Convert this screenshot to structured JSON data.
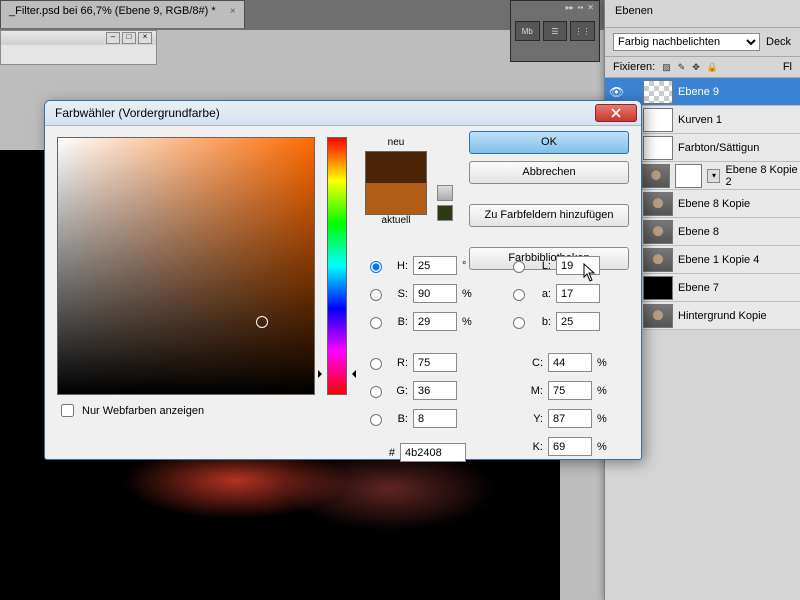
{
  "tab": {
    "title": "_Filter.psd bei 66,7% (Ebene 9, RGB/8#) *",
    "close": "×"
  },
  "panels": {
    "layers_tab": "Ebenen",
    "blend_mode": "Farbig nachbelichten",
    "deck": "Deck",
    "fix": "Fixieren:",
    "fl": "Fl",
    "mb": "Mb"
  },
  "layers": [
    {
      "name": "Ebene 9",
      "thumb": "chk",
      "selected": true
    },
    {
      "name": "Kurven 1",
      "thumb": "mask",
      "adj": true
    },
    {
      "name": "Farbton/Sättigun",
      "thumb": "mask",
      "adj": true
    },
    {
      "name": "Ebene 8 Kopie 2",
      "thumb": "cat",
      "mask": true,
      "arrow": true
    },
    {
      "name": "Ebene 8 Kopie",
      "thumb": "cat"
    },
    {
      "name": "Ebene 8",
      "thumb": "cat"
    },
    {
      "name": "Ebene 1 Kopie 4",
      "thumb": "cat"
    },
    {
      "name": "Ebene 7",
      "thumb": "blk"
    },
    {
      "name": "Hintergrund Kopie",
      "thumb": "cat"
    }
  ],
  "dialog": {
    "title": "Farbwähler (Vordergrundfarbe)",
    "new": "neu",
    "current": "aktuell",
    "ok": "OK",
    "cancel": "Abbrechen",
    "add": "Zu Farbfeldern hinzufügen",
    "libs": "Farbbibliotheken",
    "webonly": "Nur Webfarben anzeigen",
    "H": {
      "label": "H:",
      "value": "25",
      "unit": "°"
    },
    "S": {
      "label": "S:",
      "value": "90",
      "unit": "%"
    },
    "Bb": {
      "label": "B:",
      "value": "29",
      "unit": "%"
    },
    "R": {
      "label": "R:",
      "value": "75"
    },
    "G": {
      "label": "G:",
      "value": "36"
    },
    "Bv": {
      "label": "B:",
      "value": "8"
    },
    "L": {
      "label": "L:",
      "value": "19"
    },
    "a": {
      "label": "a:",
      "value": "17"
    },
    "b": {
      "label": "b:",
      "value": "25"
    },
    "C": {
      "label": "C:",
      "value": "44",
      "unit": "%"
    },
    "M": {
      "label": "M:",
      "value": "75",
      "unit": "%"
    },
    "Y": {
      "label": "Y:",
      "value": "87",
      "unit": "%"
    },
    "K": {
      "label": "K:",
      "value": "69",
      "unit": "%"
    },
    "hex": {
      "label": "#",
      "value": "4b2408"
    },
    "colors": {
      "new": "#4b2408",
      "current": "#b25d17"
    }
  }
}
